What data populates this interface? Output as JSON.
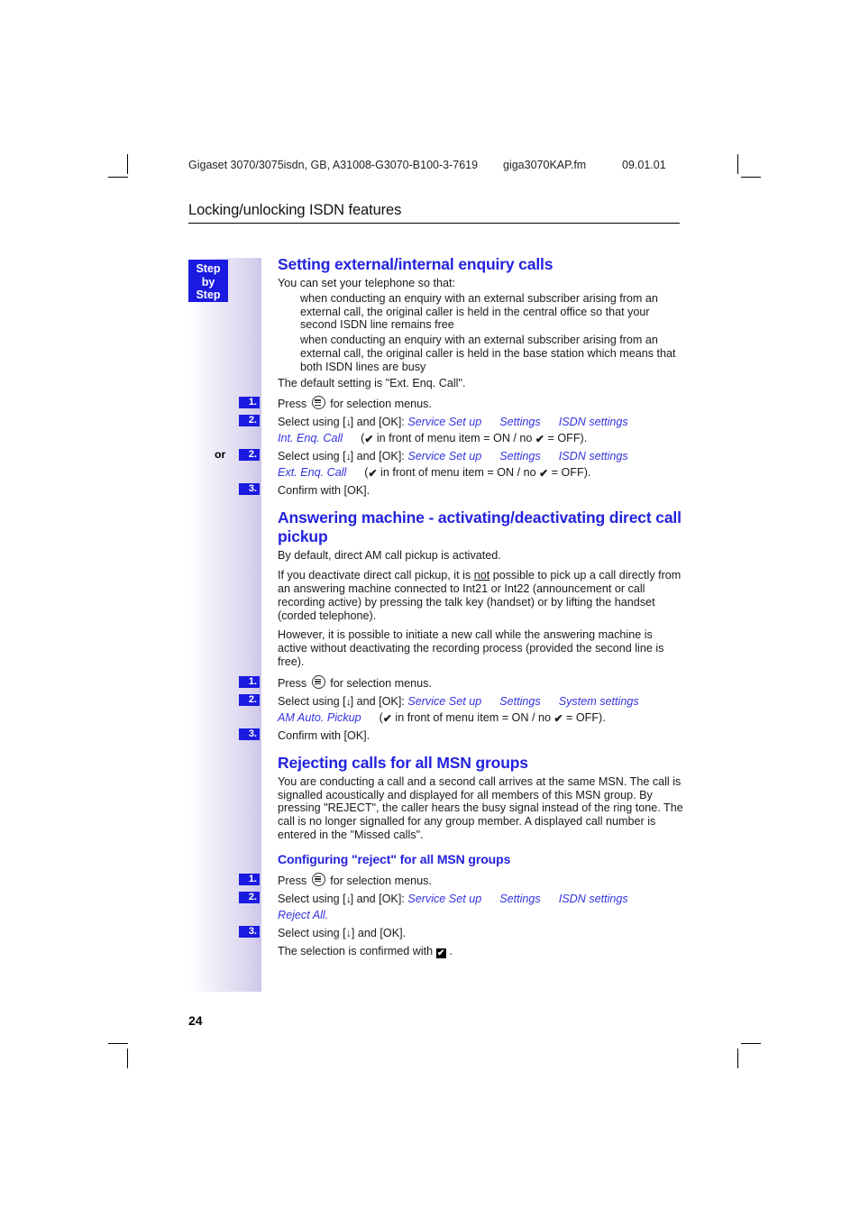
{
  "running_head": {
    "doc_ref": "Gigaset 3070/3075isdn, GB, A31008-G3070-B100-3-7619",
    "file_name": "giga3070KAP.fm",
    "doc_date": "09.01.01"
  },
  "chapter_title": "Locking/unlocking ISDN features",
  "sidebar": {
    "label": "Step by Step",
    "line1": "Step",
    "line2": "by",
    "line3": "Step"
  },
  "sections": [
    {
      "heading": "Setting external/internal enquiry calls",
      "intro": "You can set your telephone so that:",
      "bullets": [
        "when conducting an enquiry with an external subscriber arising from an external call, the original caller is held in the central office so that your second ISDN line remains free",
        "when conducting an enquiry with an external subscriber arising from an external call, the original caller is held in the base station which means that both ISDN lines are busy"
      ],
      "default_note": "The default setting is \"Ext. Enq. Call\".",
      "steps": [
        {
          "number": "1.",
          "or": "",
          "text_before": "Press",
          "icon": "menu-key-icon",
          "text_after": "for selection menus."
        },
        {
          "number": "2.",
          "or": "",
          "prefix": "Select using [",
          "arrow": "↓",
          "mid": "] and [OK]:",
          "path": [
            "Service Set up",
            "Settings",
            "ISDN settings",
            "Int. Enq. Call"
          ],
          "suffix_open": "(",
          "suffix_check": "✔",
          "suffix_text_a": " in front of menu item = ON / no ",
          "suffix_check_b": "✔",
          "suffix_text_b": " = OFF)."
        },
        {
          "number": "2.",
          "or": "or",
          "prefix": "Select using [",
          "arrow": "↓",
          "mid": "] and [OK]:",
          "path": [
            "Service Set up",
            "Settings",
            "ISDN settings",
            "Ext. Enq. Call"
          ],
          "suffix_open": "(",
          "suffix_check": "✔",
          "suffix_text_a": " in front of menu item = ON / no ",
          "suffix_check_b": "✔",
          "suffix_text_b": " = OFF)."
        },
        {
          "number": "3.",
          "or": "",
          "text_plain": "Confirm with [OK]."
        }
      ]
    },
    {
      "heading": "Answering machine - activating/deactivating direct call pickup",
      "paragraphs": [
        "By default, direct AM call pickup is activated.",
        "If you deactivate direct call pickup, it is not possible to pick up a call directly from an answering machine connected to Int21 or Int22 (announcement or call recording active) by pressing the talk key (handset) or by lifting the handset (corded telephone).",
        "However, it is possible to initiate a new call while the answering machine is active without deactivating the recording process (provided the second line is free)."
      ],
      "underlined_word": "not",
      "steps": [
        {
          "number": "1.",
          "text_before": "Press",
          "icon": "menu-key-icon",
          "text_after": "for selection menus."
        },
        {
          "number": "2.",
          "prefix": "Select using [",
          "arrow": "↓",
          "mid": "] and [OK]:",
          "path": [
            "Service Set up",
            "Settings",
            "System settings",
            "AM Auto. Pickup"
          ],
          "suffix_open": "(",
          "suffix_check": "✔",
          "suffix_text_a": " in front of menu item = ON / no ",
          "suffix_check_b": "✔",
          "suffix_text_b": " = OFF)."
        },
        {
          "number": "3.",
          "text_plain": "Confirm with [OK]."
        }
      ]
    },
    {
      "heading": "Rejecting calls for all MSN groups",
      "paragraphs": [
        "You are conducting a call and a second call arrives at the same MSN. The call is signalled acoustically and displayed for all members of this MSN group. By pressing \"REJECT\", the caller hears the busy signal instead of the ring tone. The call is no longer signalled for any group member. A displayed call number is entered in the \"Missed calls\"."
      ],
      "sub_heading": "Configuring \"reject\" for all MSN groups",
      "steps": [
        {
          "number": "1.",
          "text_before": "Press",
          "icon": "menu-key-icon",
          "text_after": "for selection menus."
        },
        {
          "number": "2.",
          "prefix": "Select using [",
          "arrow": "↓",
          "mid": "] and [OK]:",
          "path": [
            "Service Set up",
            "Settings",
            "ISDN settings",
            "Reject All."
          ]
        },
        {
          "number": "3.",
          "text_plain": "Select using [↓] and [OK]."
        }
      ],
      "confirm_note_before": "The selection is confirmed with",
      "confirm_note_box": "✔",
      "confirm_note_after": "."
    }
  ],
  "page_number": "24",
  "colors": {
    "heading_blue": "#2222dd",
    "badge_blue": "#1a1ae0",
    "sidebar_gradient_end": "#cdc6e8"
  }
}
